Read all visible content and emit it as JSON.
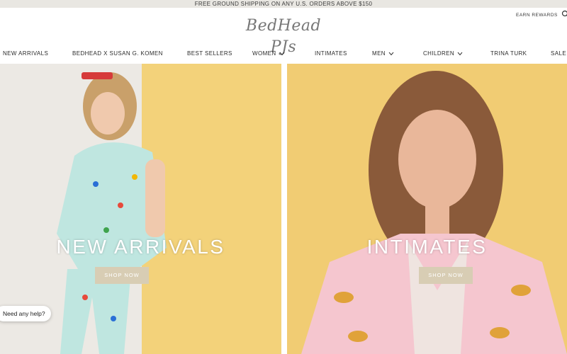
{
  "promo": {
    "text": "FREE GROUND SHIPPING ON ANY U.S. ORDERS ABOVE $150"
  },
  "header": {
    "logo_text": "BedHead PJs",
    "earn_rewards": "EARN REWARDS"
  },
  "nav": {
    "items": [
      {
        "label": "NEW ARRIVALS"
      },
      {
        "label": "BEDHEAD X SUSAN G. KOMEN"
      },
      {
        "label": "BEST SELLERS"
      },
      {
        "label": "WOMEN"
      },
      {
        "label": "INTIMATES"
      },
      {
        "label": "MEN"
      },
      {
        "label": "CHILDREN"
      },
      {
        "label": "TRINA TURK"
      },
      {
        "label": "SALE"
      }
    ]
  },
  "hero": {
    "left": {
      "title": "NEW ARRIVALS",
      "cta": "SHOP NOW"
    },
    "right": {
      "title": "INTIMATES",
      "cta": "SHOP NOW"
    }
  },
  "chat": {
    "label": "Need any help?"
  },
  "colors": {
    "promo_bg": "#e9e7e2",
    "hero_yellow": "#f1cc73",
    "cta_bg": "#d8cdb4"
  },
  "icons": [
    "search-icon",
    "chevron-down-icon"
  ]
}
